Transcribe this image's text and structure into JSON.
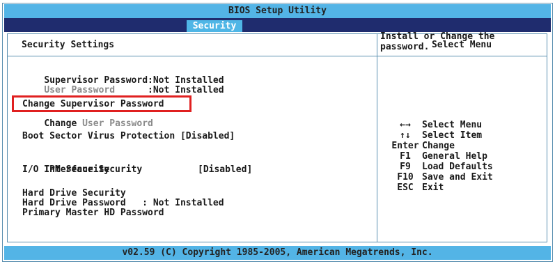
{
  "title": "BIOS Setup Utility",
  "active_tab": "Security",
  "left_pane": {
    "header": "Security Settings",
    "supervisor_password": {
      "label": "Supervisor Password",
      "value": ":Not Installed"
    },
    "user_password": {
      "label": "User Password",
      "value": ":Not Installed"
    },
    "change_supervisor": "Change Supervisor Password",
    "change_user_bold": "Change",
    "change_user_rest": " User Password",
    "boot_sector": "Boot Sector Virus Protection [Disabled]",
    "tpm_security": {
      "label": "TPM Security",
      "value": "[Disabled]"
    },
    "io_interface": "I/O Interface Security",
    "hard_drive_security": "Hard Drive Security",
    "hard_drive_password": "Hard Drive Password   : Not Installed",
    "primary_master": "Primary Master HD Password"
  },
  "right_pane": {
    "header": "Select Menu",
    "help_text": "Install or Change the password.",
    "keys": [
      {
        "key": "←→",
        "desc": "Select Menu"
      },
      {
        "key": "↑↓",
        "desc": "Select Item"
      },
      {
        "key": "Enter",
        "desc": "Change"
      },
      {
        "key": "F1",
        "desc": "General Help"
      },
      {
        "key": "F9",
        "desc": "Load Defaults"
      },
      {
        "key": "F10",
        "desc": "Save and Exit"
      },
      {
        "key": "ESC",
        "desc": "Exit"
      }
    ]
  },
  "footer": "v02.59 (C) Copyright 1985-2005, American Megatrends, Inc.",
  "colors": {
    "title_bar": "#53b4e6",
    "tab_bar": "#1f2c6e",
    "highlight": "#e02020"
  }
}
